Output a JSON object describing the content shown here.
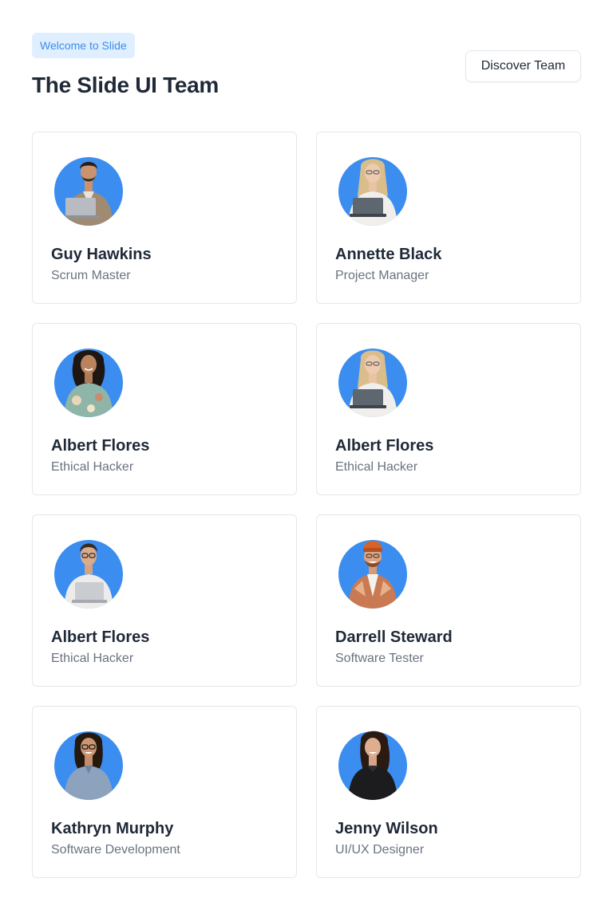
{
  "header": {
    "badge": "Welcome to Slide",
    "title": "The Slide UI Team",
    "discover_button": "Discover Team"
  },
  "colors": {
    "accent": "#3b8eea",
    "badge_bg": "#e0efff",
    "avatar_bg": "#3b8ef0",
    "border": "#e5e7eb",
    "role_text": "#6b7280"
  },
  "team": [
    {
      "name": "Guy Hawkins",
      "role": "Scrum Master",
      "icon": "avatar-man-laptop"
    },
    {
      "name": "Annette Black",
      "role": "Project Manager",
      "icon": "avatar-woman-laptop"
    },
    {
      "name": "Albert Flores",
      "role": "Ethical Hacker",
      "icon": "avatar-woman-curly"
    },
    {
      "name": "Albert Flores",
      "role": "Ethical Hacker",
      "icon": "avatar-woman-laptop"
    },
    {
      "name": "Albert Flores",
      "role": "Ethical Hacker",
      "icon": "avatar-man-glasses-laptop"
    },
    {
      "name": "Darrell Steward",
      "role": "Software Tester",
      "icon": "avatar-man-beanie"
    },
    {
      "name": "Kathryn Murphy",
      "role": "Software Development",
      "icon": "avatar-woman-glasses"
    },
    {
      "name": "Jenny Wilson",
      "role": "UI/UX Designer",
      "icon": "avatar-woman-black-shirt"
    }
  ]
}
